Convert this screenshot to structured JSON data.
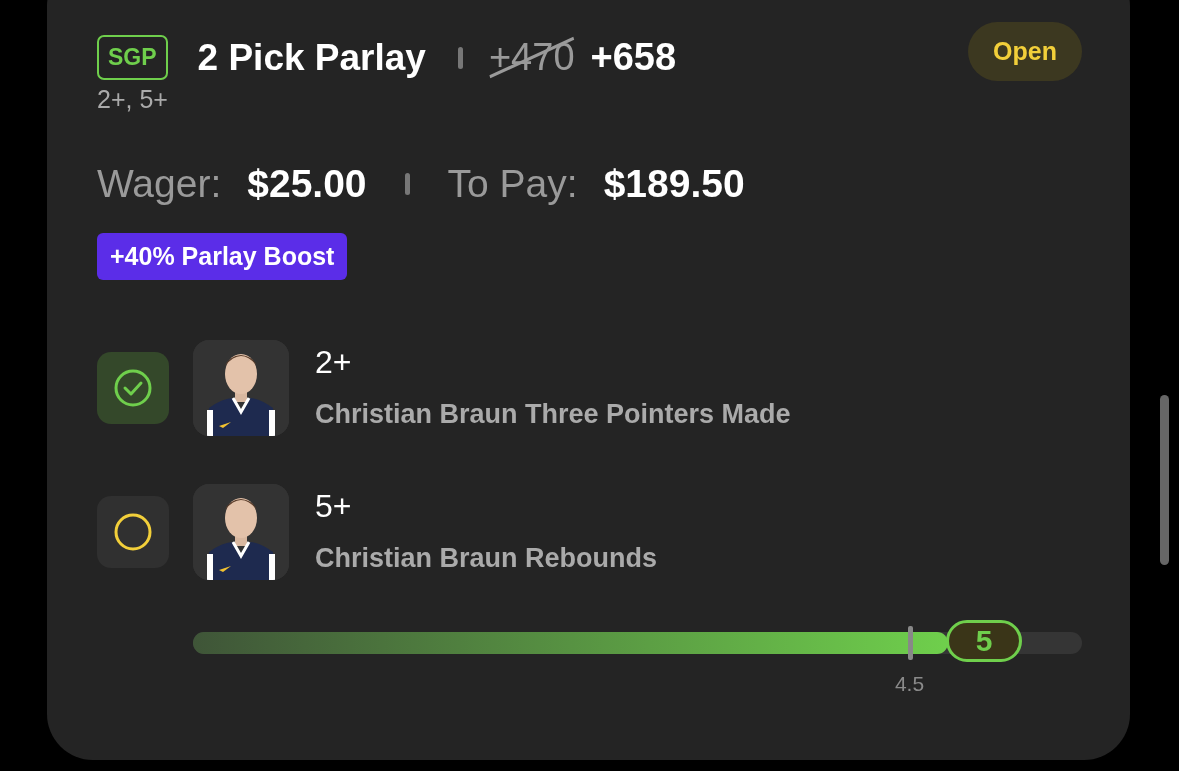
{
  "bet": {
    "tag": "SGP",
    "title": "2 Pick Parlay",
    "original_odds": "+470",
    "odds": "+658",
    "status": "Open",
    "summary": "2+, 5+",
    "wager_label": "Wager:",
    "wager": "$25.00",
    "payout_label": "To Pay:",
    "payout": "$189.50",
    "boost": "+40% Parlay Boost",
    "legs": [
      {
        "kind": "won",
        "line": "2+",
        "market": "Christian Braun Three Pointers Made"
      },
      {
        "kind": "pending",
        "line": "5+",
        "market": "Christian Braun Rebounds",
        "progress": {
          "level": 0.89,
          "value": "5",
          "target": "4.5"
        }
      }
    ]
  }
}
